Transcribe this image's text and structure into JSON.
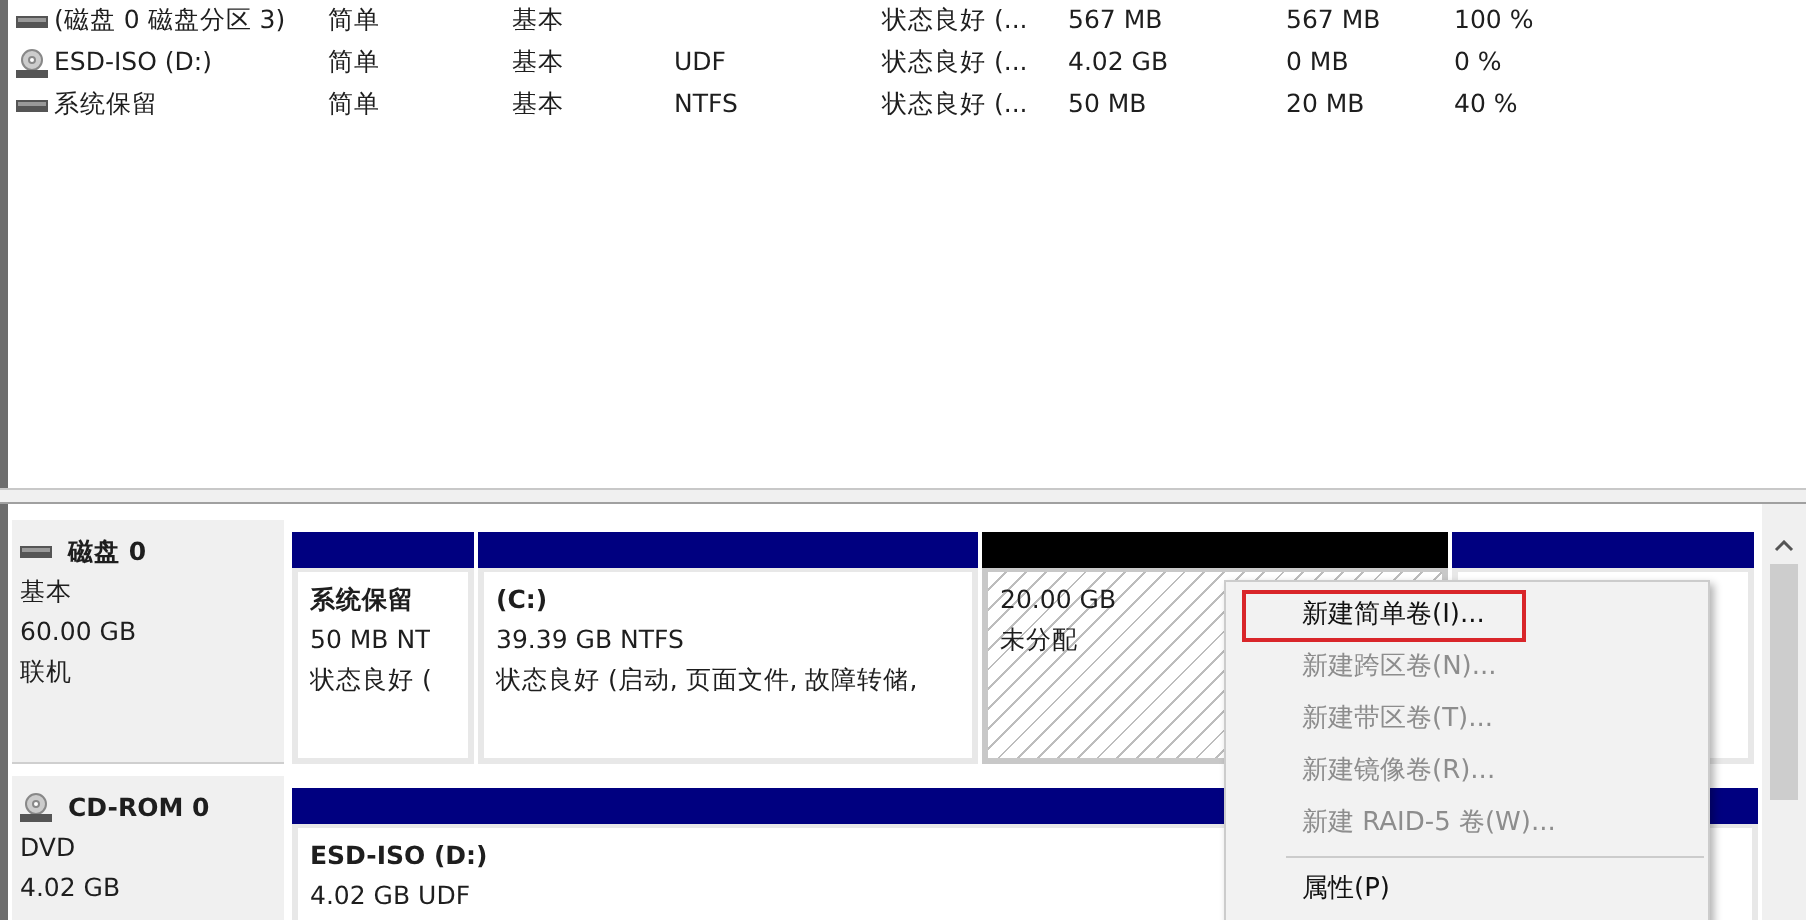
{
  "volumes": [
    {
      "kind": "disk",
      "name": "(磁盘 0 磁盘分区 3)",
      "layout": "简单",
      "type": "基本",
      "status": "状态良好 (...",
      "capacity": "567 MB",
      "free": "567 MB",
      "pct": "100 %"
    },
    {
      "kind": "cdrom",
      "name": "ESD-ISO (D:)",
      "layout": "简单",
      "type": "基本",
      "fs": "UDF",
      "status": "状态良好 (...",
      "capacity": "4.02 GB",
      "free": "0 MB",
      "pct": "0 %"
    },
    {
      "kind": "disk",
      "name": "系统保留",
      "layout": "简单",
      "type": "基本",
      "fs": "NTFS",
      "status": "状态良好 (...",
      "capacity": "50 MB",
      "free": "20 MB",
      "pct": "40 %"
    }
  ],
  "disks": [
    {
      "kind": "disk",
      "name": "磁盘 0",
      "type": "基本",
      "size": "60.00 GB",
      "state": "联机",
      "partitions": [
        {
          "kind": "primary",
          "title": "系统保留",
          "size": "50 MB NT",
          "status": "状态良好 ("
        },
        {
          "kind": "primary",
          "title": "(C:)",
          "size": "39.39 GB NTFS",
          "status": "状态良好 (启动, 页面文件, 故障转储,"
        },
        {
          "kind": "unallocated",
          "size": "20.00 GB",
          "status": "未分配"
        },
        {
          "kind": "primary"
        }
      ]
    },
    {
      "kind": "cdrom",
      "name": "CD-ROM 0",
      "type": "DVD",
      "size": "4.02 GB",
      "partitions": [
        {
          "kind": "primary",
          "title": "ESD-ISO  (D:)",
          "size": "4.02 GB UDF"
        }
      ]
    }
  ],
  "menu": [
    {
      "kind": "item",
      "label": "新建简单卷(I)...",
      "disabled": false,
      "highlighted": true
    },
    {
      "kind": "item",
      "label": "新建跨区卷(N)...",
      "disabled": true,
      "highlighted": false
    },
    {
      "kind": "item",
      "label": "新建带区卷(T)...",
      "disabled": true,
      "highlighted": false
    },
    {
      "kind": "item",
      "label": "新建镜像卷(R)...",
      "disabled": true,
      "highlighted": false
    },
    {
      "kind": "item",
      "label": "新建 RAID-5 卷(W)...",
      "disabled": true,
      "highlighted": false
    },
    {
      "kind": "separator"
    },
    {
      "kind": "item",
      "label": "属性(P)",
      "disabled": false,
      "highlighted": false
    }
  ]
}
